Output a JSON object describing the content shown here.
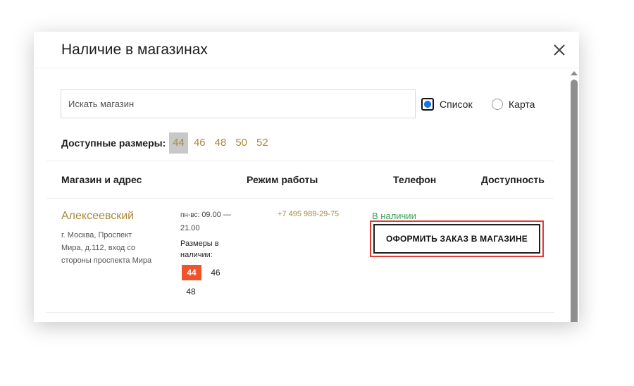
{
  "modal": {
    "title": "Наличие в магазинах"
  },
  "search": {
    "placeholder": "Искать магазин",
    "value": ""
  },
  "view_toggle": {
    "list_label": "Список",
    "map_label": "Карта",
    "selected": "Список"
  },
  "sizes_filter": {
    "label": "Доступные размеры:",
    "options": [
      "44",
      "46",
      "48",
      "50",
      "52"
    ],
    "selected": "44"
  },
  "table": {
    "headers": {
      "store": "Магазин и адрес",
      "hours": "Режим работы",
      "phone": "Телефон",
      "availability": "Доступность"
    },
    "rows": [
      {
        "name": "Алексеевский",
        "address": "г. Москва, Проспект Мира, д.112, вход со стороны проспекта Мира",
        "hours_days": "пн-вс:",
        "hours_time": "09.00 — 21.00",
        "sizes_label": "Размеры в наличии:",
        "sizes": [
          "44",
          "46",
          "48"
        ],
        "highlighted_size": "44",
        "phone": "+7 495 989-29-75",
        "availability": "В наличии",
        "order_button": "ОФОРМИТЬ ЗАКАЗ В МАГАЗИНЕ"
      }
    ]
  },
  "colors": {
    "accent": "#a88a3c",
    "in_stock": "#3aa05a",
    "size_highlight": "#f0522a",
    "annotation_box": "#e53935"
  }
}
